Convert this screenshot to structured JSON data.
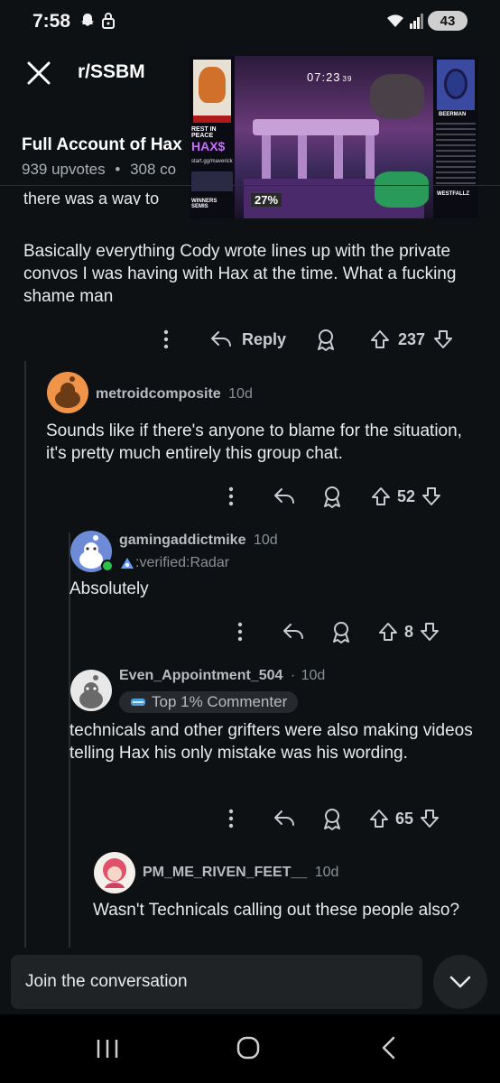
{
  "status": {
    "time": "7:58",
    "battery": "43"
  },
  "header": {
    "subreddit": "r/SSBM"
  },
  "post": {
    "title": "Full Account of Hax",
    "upvotes": "939 upvotes",
    "sep": "•",
    "comments": "308 co"
  },
  "video": {
    "clock": "07:23",
    "clock_small": "39",
    "percent": "27%",
    "left_caption": "REST IN PEACE",
    "left_hax": "HAX$",
    "left_url": "start.gg/maverick",
    "left_round": "WINNERS SEMIS",
    "right_name": "BEERMAN",
    "right_wins": "WESTFALLZ"
  },
  "main_comment": {
    "cut_line": "there was a way to",
    "paragraph": "Basically everything Cody wrote lines up with the private convos I was having with Hax at the time. What a fucking shame man",
    "reply_label": "Reply",
    "votes": "237"
  },
  "comments": [
    {
      "user": "metroidcomposite",
      "age": "10d",
      "text": "Sounds like if there's anyone to blame for the situation, it's pretty much entirely this group chat.",
      "votes": "52",
      "avatar_color": "#f0944a"
    },
    {
      "user": "gamingaddictmike",
      "age": "10d",
      "flair": ":verified:Radar",
      "text": "Absolutely",
      "votes": "8",
      "avatar_color": "#6d8bd6"
    },
    {
      "user": "Even_Appointment_504",
      "age": "10d",
      "badge": "Top 1% Commenter",
      "text": "technicals and other grifters were also making videos telling Hax his only mistake was his wording.",
      "votes": "65",
      "avatar_color": "#e8e8e8"
    },
    {
      "user": "PM_ME_RIVEN_FEET__",
      "age": "10d",
      "text": "Wasn't Technicals calling out these people also?",
      "avatar_color": "#e8e8e8"
    }
  ],
  "bottom": {
    "join_label": "Join the conversation"
  },
  "dot": "·"
}
